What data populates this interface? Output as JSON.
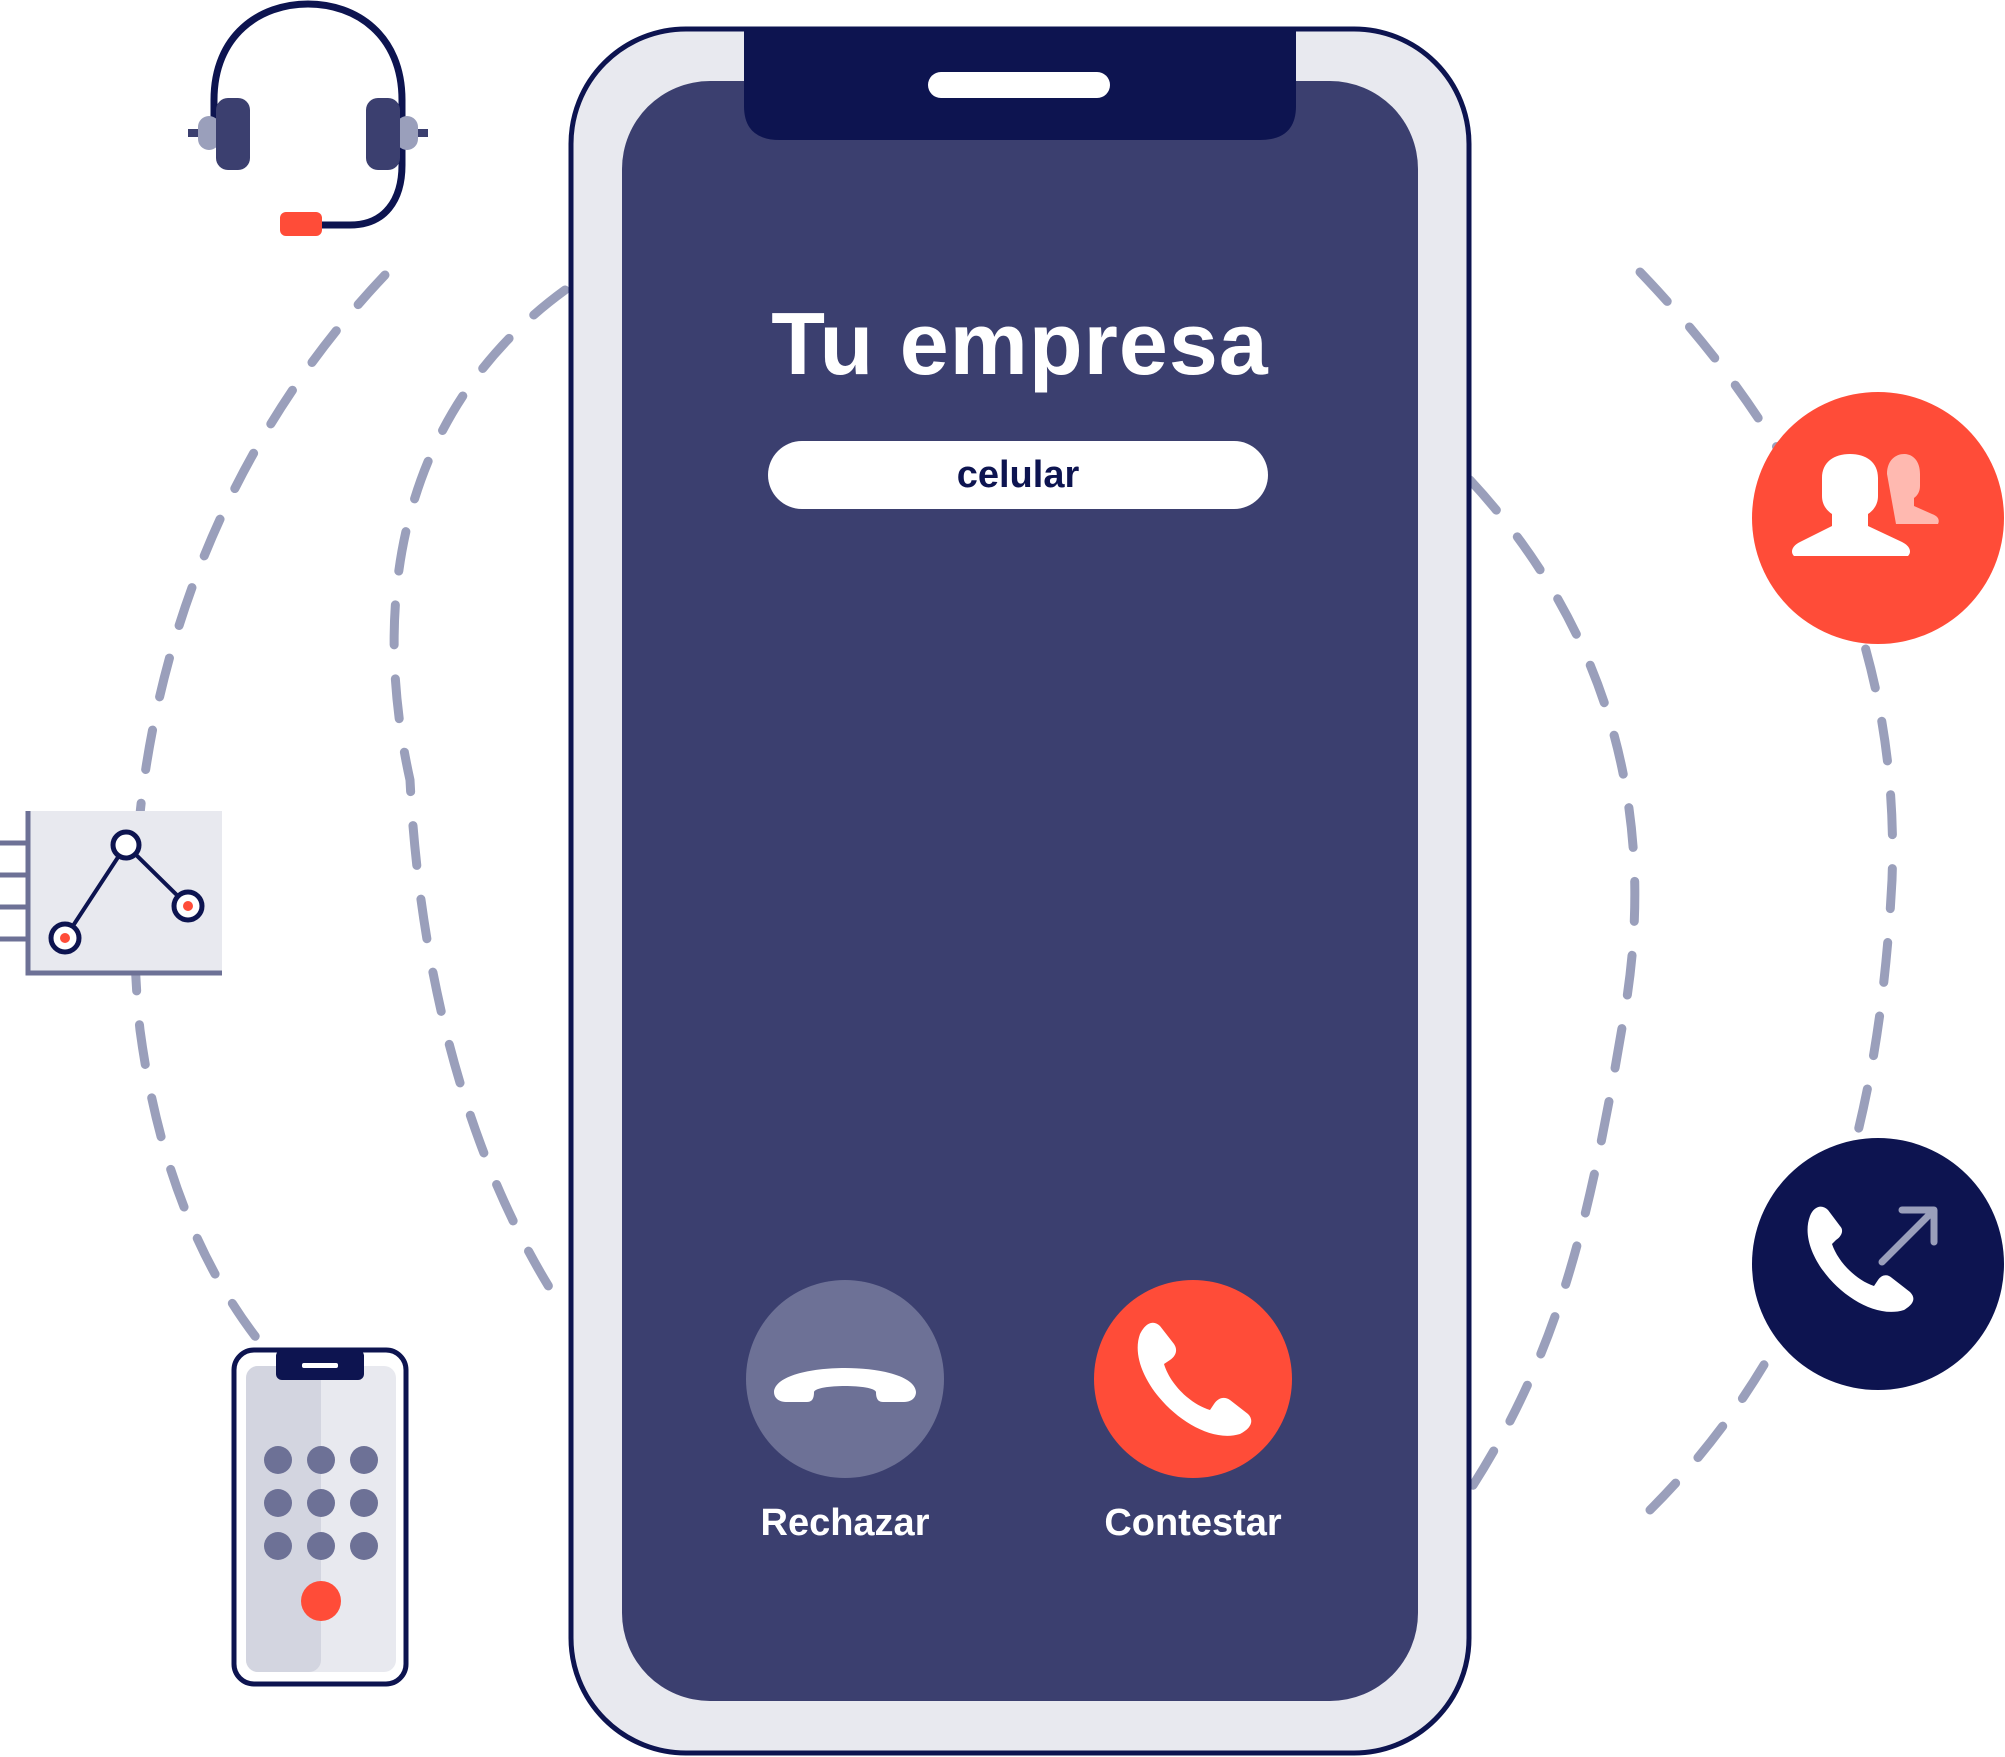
{
  "call": {
    "caller_name": "Tu empresa",
    "line_type": "celular",
    "reject_label": "Rechazar",
    "answer_label": "Contestar"
  },
  "icons": {
    "headset": "headset-icon",
    "analytics": "line-chart-icon",
    "mobile_dialer": "dialpad-phone-icon",
    "contacts": "contacts-icon",
    "call_forward": "call-forward-icon",
    "hang_up": "hang-up-icon",
    "answer": "answer-phone-icon"
  },
  "colors": {
    "navy": "#0d1450",
    "screen": "#3b3f6f",
    "frame": "#e8e9ef",
    "accent_red": "#ff4c38",
    "reject_gray": "#6d7196",
    "dash": "#9a9fbb"
  }
}
